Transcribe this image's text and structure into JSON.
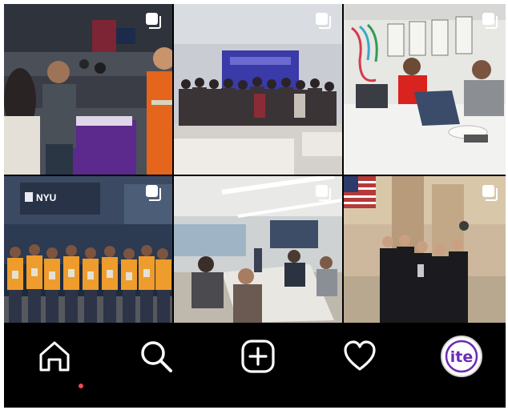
{
  "feed": {
    "posts": [
      {
        "name": "post-career-fair",
        "multi_icon": "carousel-icon"
      },
      {
        "name": "post-group-presentation",
        "multi_icon": "carousel-icon"
      },
      {
        "name": "post-lab-students",
        "multi_icon": "carousel-icon"
      },
      {
        "name": "post-nyu-group-vests",
        "multi_icon": "carousel-icon"
      },
      {
        "name": "post-open-workspace",
        "multi_icon": "carousel-icon"
      },
      {
        "name": "post-award-group",
        "multi_icon": "carousel-icon"
      }
    ],
    "signage": {
      "building_sign": "NYU"
    }
  },
  "bottom_nav": {
    "items": [
      {
        "icon": "home-icon",
        "active": true
      },
      {
        "icon": "search-icon",
        "active": false
      },
      {
        "icon": "new-post-icon",
        "active": false
      },
      {
        "icon": "activity-heart-icon",
        "active": false
      },
      {
        "icon": "profile-avatar",
        "active": false
      }
    ],
    "profile_avatar_text": "ite",
    "notification_dot_color": "#ed4956"
  },
  "colors": {
    "nav_background": "#000000",
    "icon_color": "#ffffff",
    "avatar_text": "#6a2bb5"
  }
}
